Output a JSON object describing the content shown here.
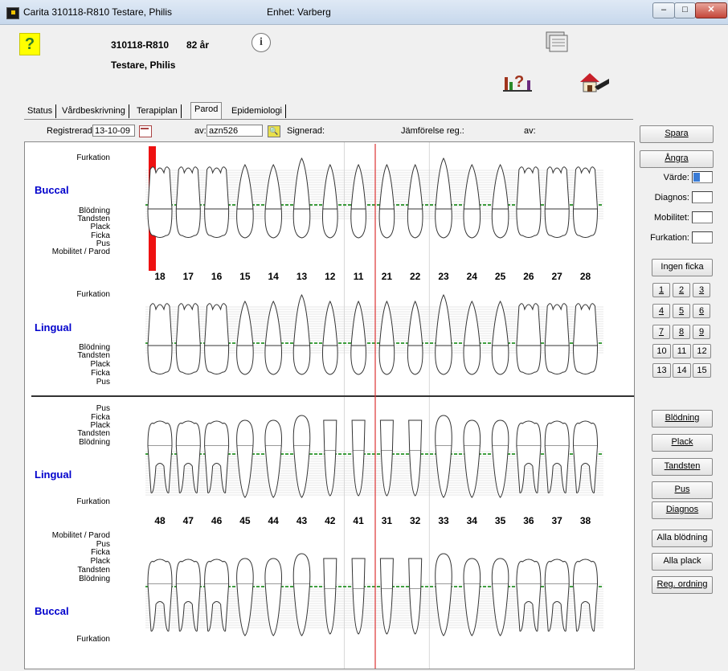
{
  "window": {
    "title": "Carita    310118-R810  Testare, Philis",
    "unit": "Enhet: Varberg",
    "controls": {
      "minimize": "–",
      "maximize": "□",
      "close": "✕"
    }
  },
  "patient": {
    "id": "310118-R810",
    "age": "82 år",
    "name": "Testare, Philis"
  },
  "icons": {
    "help": "?",
    "info": "i",
    "document": "document-stack-icon",
    "statistics": "statistics-chart-icon",
    "home": "home-icon"
  },
  "tabs": [
    {
      "label": "Status",
      "active": false
    },
    {
      "label": "Vårdbeskrivning",
      "active": false
    },
    {
      "label": "Terapiplan",
      "active": false
    },
    {
      "label": "Parod",
      "active": true
    },
    {
      "label": "Epidemiologi",
      "active": false
    }
  ],
  "registration": {
    "registrerad_label": "Registrerad:",
    "registrerad_value": "13-10-09",
    "av_label": "av:",
    "av_value": "azn526",
    "signerad_label": "Signerad:",
    "jamforelse_label": "Jämförelse reg.:",
    "av2_label": "av:"
  },
  "chart": {
    "upper_buccal": {
      "jaw": "Buccal",
      "rows": [
        "Furkation",
        "Blödning",
        "Tandsten",
        "Plack",
        "Ficka",
        "Pus",
        "Mobilitet / Parod"
      ]
    },
    "upper_lingual": {
      "jaw": "Lingual",
      "rows": [
        "Furkation",
        "Blödning",
        "Tandsten",
        "Plack",
        "Ficka",
        "Pus"
      ]
    },
    "lower_lingual": {
      "jaw": "Lingual",
      "rows": [
        "Pus",
        "Ficka",
        "Plack",
        "Tandsten",
        "Blödning",
        "Furkation"
      ]
    },
    "lower_buccal": {
      "jaw": "Buccal",
      "rows": [
        "Mobilitet / Parod",
        "Pus",
        "Ficka",
        "Plack",
        "Tandsten",
        "Blödning",
        "Furkation"
      ]
    },
    "upper_teeth": [
      "18",
      "17",
      "16",
      "15",
      "14",
      "13",
      "12",
      "11",
      "21",
      "22",
      "23",
      "24",
      "25",
      "26",
      "27",
      "28"
    ],
    "lower_teeth": [
      "48",
      "47",
      "46",
      "45",
      "44",
      "43",
      "42",
      "41",
      "31",
      "32",
      "33",
      "34",
      "35",
      "36",
      "37",
      "38"
    ],
    "selected_tooth": "18",
    "colors": {
      "selection": "#ee1111",
      "gumline": "#008000",
      "midline": "#dd3333",
      "jaw_label": "#0000cc"
    }
  },
  "panel": {
    "spara": "Spara",
    "angra": "Ångra",
    "varde_label": "Värde:",
    "diagnos_label": "Diagnos:",
    "mobilitet_label": "Mobilitet:",
    "furkation_label": "Furkation:",
    "ingen_ficka": "Ingen ficka",
    "numbers": [
      "1",
      "2",
      "3",
      "4",
      "5",
      "6",
      "7",
      "8",
      "9",
      "10",
      "11",
      "12",
      "13",
      "14",
      "15"
    ],
    "blodning": "Blödning",
    "plack": "Plack",
    "tandsten": "Tandsten",
    "pus": "Pus",
    "diagnos": "Diagnos",
    "alla_blodning": "Alla blödning",
    "alla_plack": "Alla plack",
    "reg_ordning": "Reg. ordning"
  }
}
